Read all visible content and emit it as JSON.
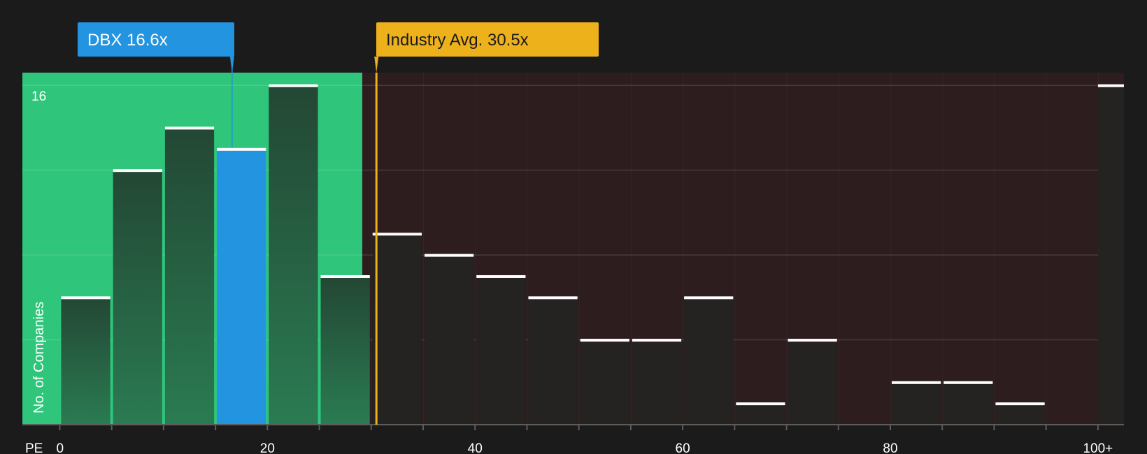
{
  "chart_data": {
    "type": "bar",
    "title": "",
    "xlabel": "PE",
    "ylabel": "No. of Companies",
    "x_ticks": [
      "0",
      "20",
      "40",
      "60",
      "80",
      "100+"
    ],
    "x_tick_values": [
      0,
      20,
      40,
      60,
      80,
      100
    ],
    "y_max_label": "16",
    "ylim": [
      0,
      16.6
    ],
    "xlim": [
      -3.6,
      102.5
    ],
    "bin_width": 5,
    "bins": [
      {
        "x0": 0,
        "x1": 5,
        "value": 6
      },
      {
        "x0": 5,
        "x1": 10,
        "value": 12
      },
      {
        "x0": 10,
        "x1": 15,
        "value": 14
      },
      {
        "x0": 15,
        "x1": 20,
        "value": 13,
        "highlight": true
      },
      {
        "x0": 20,
        "x1": 25,
        "value": 16
      },
      {
        "x0": 25,
        "x1": 30,
        "value": 7
      },
      {
        "x0": 30,
        "x1": 35,
        "value": 9
      },
      {
        "x0": 35,
        "x1": 40,
        "value": 8
      },
      {
        "x0": 40,
        "x1": 45,
        "value": 7
      },
      {
        "x0": 45,
        "x1": 50,
        "value": 6
      },
      {
        "x0": 50,
        "x1": 55,
        "value": 4
      },
      {
        "x0": 55,
        "x1": 60,
        "value": 4
      },
      {
        "x0": 60,
        "x1": 65,
        "value": 6
      },
      {
        "x0": 65,
        "x1": 70,
        "value": 1
      },
      {
        "x0": 70,
        "x1": 75,
        "value": 4
      },
      {
        "x0": 75,
        "x1": 80,
        "value": 0
      },
      {
        "x0": 80,
        "x1": 85,
        "value": 2
      },
      {
        "x0": 85,
        "x1": 90,
        "value": 2
      },
      {
        "x0": 90,
        "x1": 95,
        "value": 1
      },
      {
        "x0": 95,
        "x1": 100,
        "value": 0
      },
      {
        "x0": 100,
        "x1": 102.5,
        "value": 16,
        "overflow": true
      }
    ],
    "markers": [
      {
        "name": "DBX",
        "label": "DBX 16.6x",
        "value": 16.6,
        "color": "#2394e0"
      },
      {
        "name": "Industry Avg.",
        "label": "Industry Avg. 30.5x",
        "value": 30.5,
        "color": "#edb11c"
      }
    ],
    "fair_zone_end": 29.4,
    "grid": true
  },
  "colors": {
    "background": "#1b1b1c",
    "fair_zone": "#2fc57b",
    "fair_bar_top": "#234734",
    "fair_bar_bottom": "#2a7b52",
    "expensive_zone": "#2d1d1e",
    "expensive_bar": "#252222",
    "highlight_bar": "#2394e0",
    "cap_line": "#ffffff",
    "axis": "#5c5c5c",
    "dbx_marker": "#2394e0",
    "industry_marker": "#edb11c",
    "industry_text": "#1b1b1c",
    "dbx_text": "#ffffff"
  }
}
